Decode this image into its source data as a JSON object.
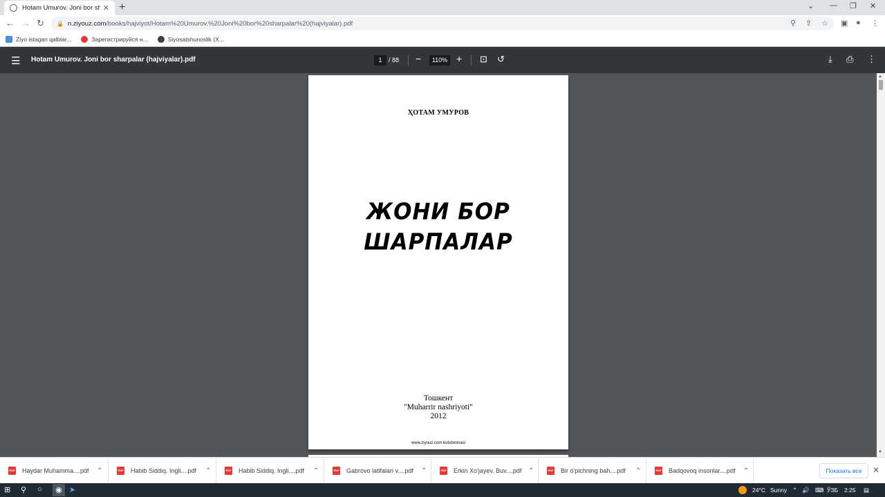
{
  "browser": {
    "tab_title": "Hotam Umurov. Joni bor sharpalar (hajviyalar).pdf",
    "tab_close": "✕",
    "new_tab": "+",
    "url_host": "n.ziyouz.com",
    "url_path": "/books/hajviyot/Hotam%20Umurov.%20Joni%20bor%20sharpalar%20(hajviyalar).pdf"
  },
  "bookmarks": [
    {
      "label": "Ziyo istagan qalblar...",
      "color": "#4a8fe7"
    },
    {
      "label": "Зарегистрируйся н...",
      "color": "#e53935"
    },
    {
      "label": "Siyosatshunoslik (X...",
      "color": "#3c4043"
    }
  ],
  "pdf_viewer": {
    "title": "Hotam Umurov. Joni bor sharpalar (hajviyalar).pdf",
    "current_page": "1",
    "total_pages": "/ 88",
    "zoom": "110%"
  },
  "document": {
    "author": "ҲОТАМ УМУРОВ",
    "title_line1": "ЖОНИ БОР",
    "title_line2": "ШАРПАЛАР",
    "city": "Тошкент",
    "publisher": "\"Muharrir  nashriyoti\"",
    "year": "2012",
    "site": "www.ziyouz.com kutubxonasi"
  },
  "downloads": {
    "items": [
      {
        "name": "Haydar Muhamma....pdf"
      },
      {
        "name": "Habib Siddiq. Ingli....pdf"
      },
      {
        "name": "Habib Siddiq. Ingli....pdf"
      },
      {
        "name": "Gabrovo latifalari v....pdf"
      },
      {
        "name": "Erkin Xo'jayev. Buv....pdf"
      },
      {
        "name": "Bir o'pichning bah....pdf"
      },
      {
        "name": "Badqovoq insonlar....pdf"
      }
    ],
    "show_all": "Показать все",
    "file_badge": "PDF"
  },
  "taskbar": {
    "temperature": "24°C",
    "weather": "Sunny",
    "language": "ЎЗБ",
    "time": "2:25"
  }
}
